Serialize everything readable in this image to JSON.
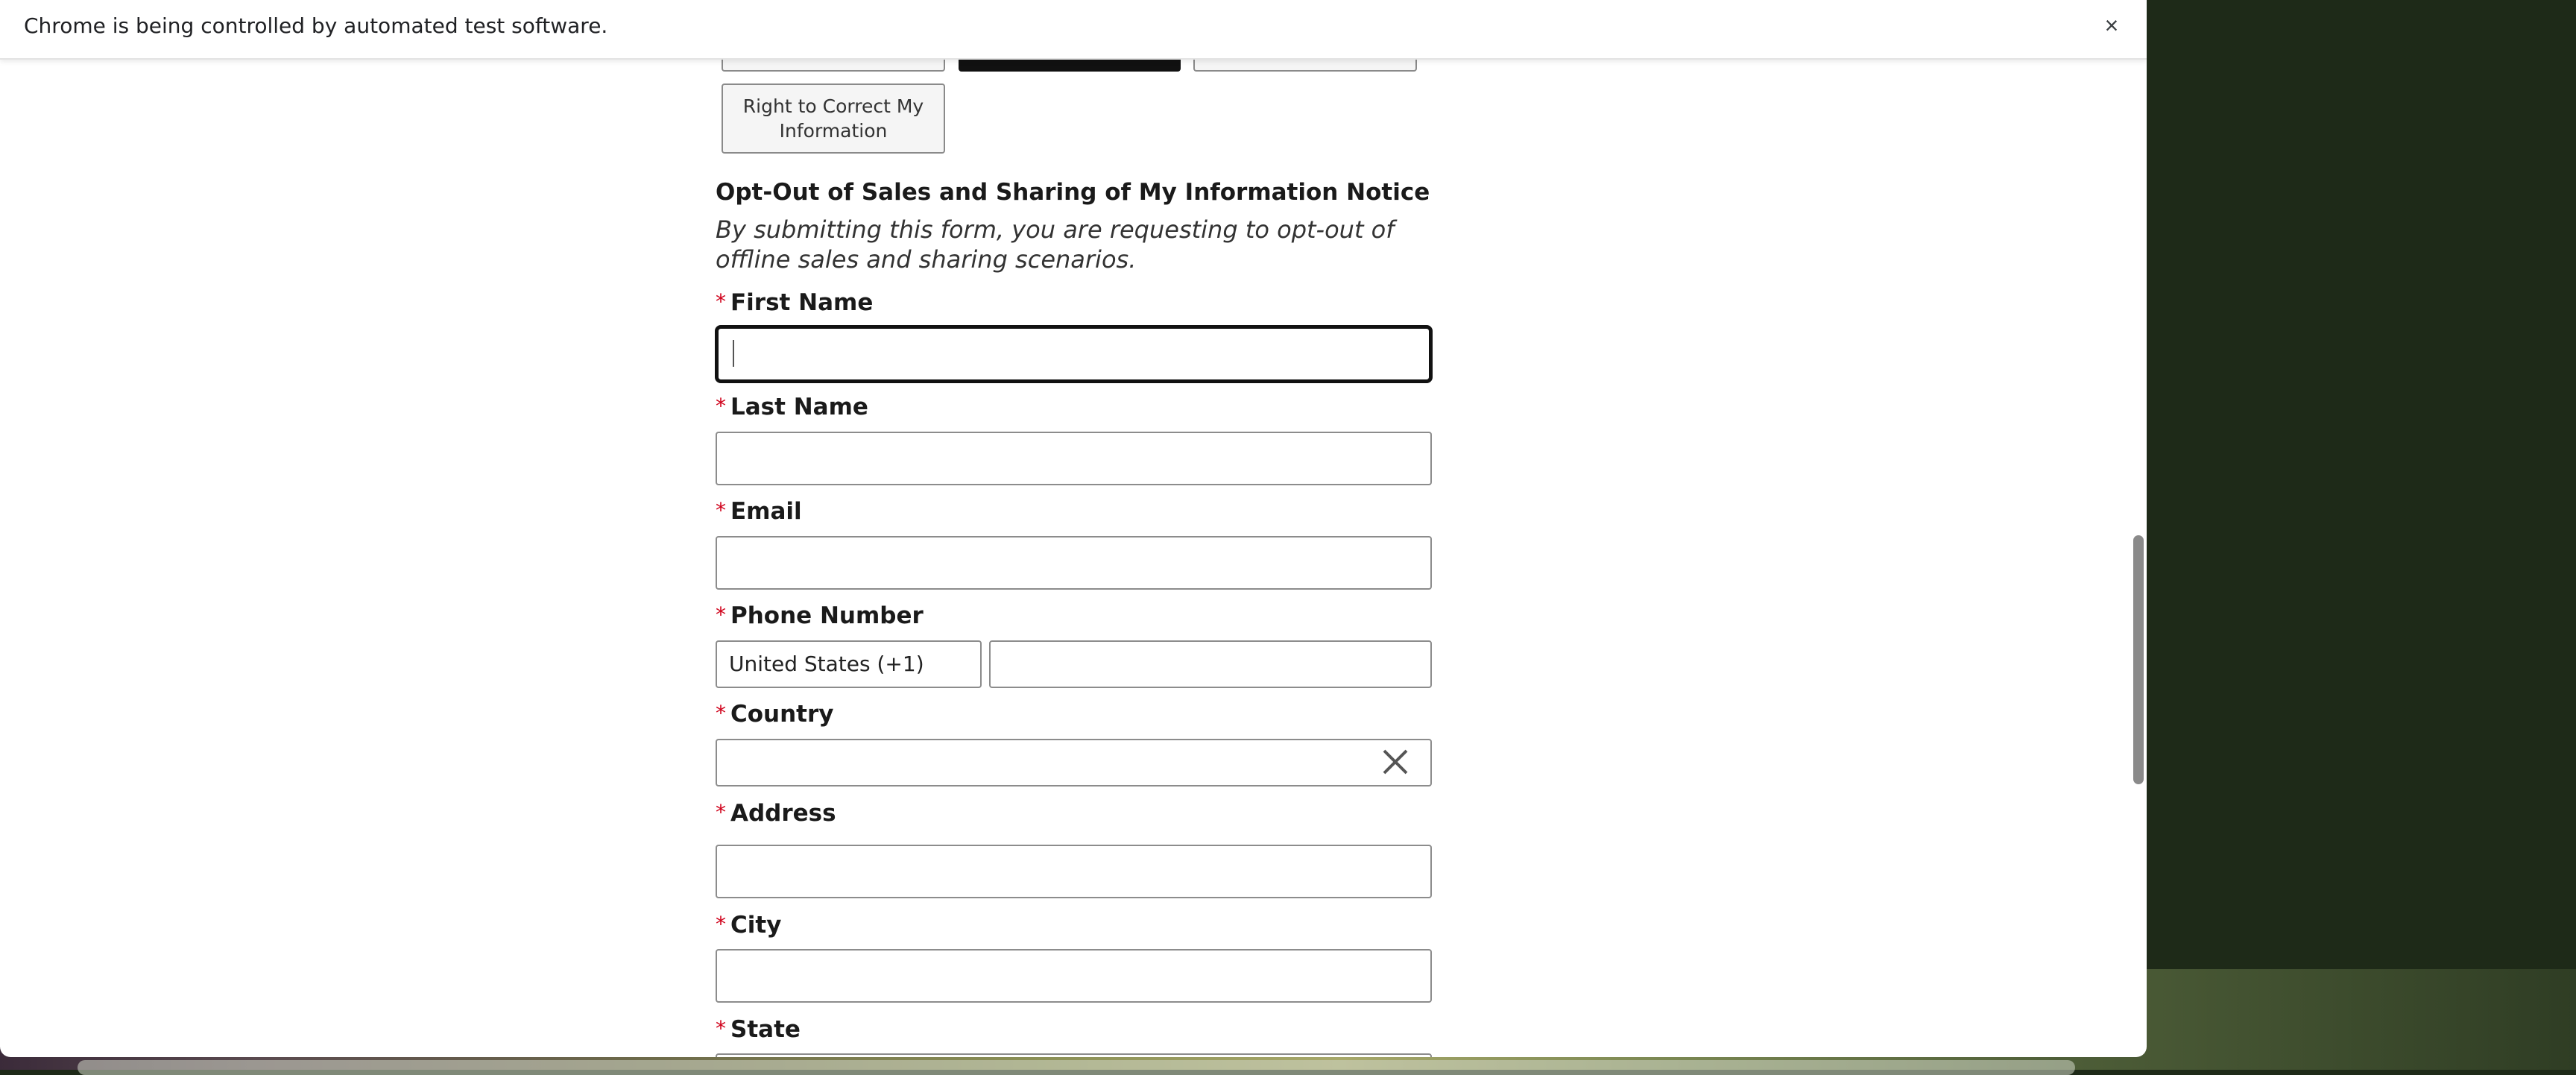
{
  "infobar": {
    "message": "Chrome is being controlled by automated test software.",
    "close_glyph": "×"
  },
  "request_types": {
    "items": [
      {
        "label": ""
      },
      {
        "label": "",
        "selected": true
      },
      {
        "label": ""
      },
      {
        "label": "Right to Correct My Information"
      }
    ]
  },
  "notice": {
    "heading": "Opt-Out of Sales and Sharing of My Information Notice",
    "description": "By submitting this form, you are requesting to opt-out of offline sales and sharing scenarios."
  },
  "form": {
    "required_marker": "*",
    "first_name": {
      "label": "First Name",
      "value": ""
    },
    "last_name": {
      "label": "Last Name",
      "value": ""
    },
    "email": {
      "label": "Email",
      "value": ""
    },
    "phone": {
      "label": "Phone Number",
      "country_code": "United States (+1)",
      "value": ""
    },
    "country": {
      "label": "Country",
      "value": "",
      "clear_icon": "close-icon"
    },
    "address": {
      "label": "Address",
      "value": ""
    },
    "city": {
      "label": "City",
      "value": ""
    },
    "state": {
      "label": "State",
      "value": ""
    }
  },
  "colors": {
    "required": "#d0021b",
    "selected_button": "#111111",
    "field_border": "#8c8c8c"
  }
}
